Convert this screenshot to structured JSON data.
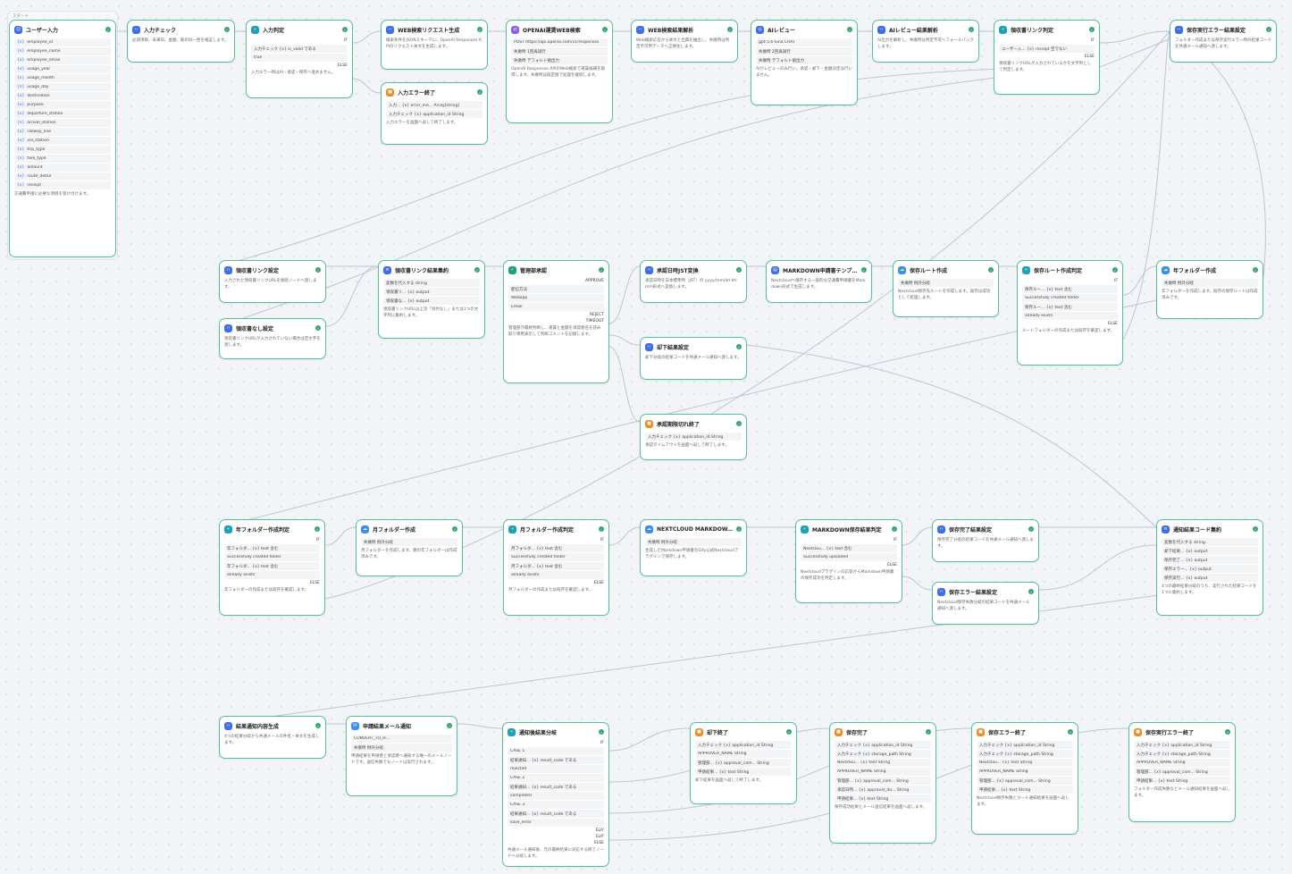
{
  "canvas": {
    "group_label": "スタート"
  },
  "nodes": [
    {
      "title": "ユーザー入力",
      "icon": "user-icon",
      "color": "#3b6ff0",
      "rows": [
        "employee_id",
        "employee_name",
        "employee_email",
        "usage_year",
        "usage_month",
        "usage_day",
        "destination",
        "purpose",
        "departure_station",
        "arrival_station",
        "railway_line",
        "via_station",
        "trip_type",
        "fare_type",
        "amount",
        "route_detail",
        "receipt"
      ],
      "desc": "交通費申請に必要な項目を受け付けます。"
    },
    {
      "title": "入力チェック",
      "icon": "code-icon",
      "color": "#3b6ff0",
      "rows": [],
      "desc": "必須項目、未来日、金額、駅の同一性を検証します。"
    },
    {
      "title": "入力判定",
      "icon": "branch-icon",
      "color": "#1aa3b8",
      "rows": [
        "入力チェック {x} is_valid である",
        "true"
      ],
      "labels": [
        "IF",
        "ELSE"
      ],
      "desc": "入力エラー時はAI・承認・保存へ進めません。"
    },
    {
      "title": "入力エラー終了",
      "icon": "end-icon",
      "color": "#f08c1e",
      "rows": [
        "入力... {x} error_me... Array[string]",
        "入力チェック {x} application_id String"
      ],
      "desc": "入力エラーを画面へ返して終了します。"
    },
    {
      "title": "WEB検索リクエスト生成",
      "icon": "code-icon",
      "color": "#3b6ff0",
      "rows": [],
      "desc": "検索条件をJSONスキーマに、OpenAI Responses APIのリクエスト本文を生成します。"
    },
    {
      "title": "OPENAI運賃WEB検索",
      "icon": "api-icon",
      "color": "#8b5cf6",
      "rows": [
        "POST https://api.openai.com/v1/responses",
        "失敗時 1回再試行",
        "失敗時 デフォルト値出力"
      ],
      "desc": "OpenAI Responses APIのWeb検索で運賃候補を取得します。失敗時は既定値で処理を継続します。"
    },
    {
      "title": "WEB検索結果解析",
      "icon": "code-icon",
      "color": "#3b6ff0",
      "rows": [],
      "desc": "Web検索応答から本文と出典を抽出し、失敗時は判定不可用データへ正規化します。"
    },
    {
      "title": "AIレビュー",
      "icon": "llm-icon",
      "color": "#3b6ff0",
      "rows": [
        "gpt-5.6-luna CHAT",
        "失敗時 2回再試行",
        "失敗時 デフォルト値出力"
      ],
      "desc": "AIがレビューのみ行い、承認・却下・金額決定は行いません。"
    },
    {
      "title": "AIレビュー結果解析",
      "icon": "code-icon",
      "color": "#3b6ff0",
      "rows": [],
      "desc": "AI出力を解析し、失敗時は判定不可へフォールバックします。"
    },
    {
      "title": "領収書リンク判定",
      "icon": "branch-icon",
      "color": "#1aa3b8",
      "rows": [
        "ユーザー入... {x} receipt 空でない"
      ],
      "labels": [
        "IF",
        "ELSE"
      ],
      "desc": "領収書リンクURLが入力されているかを文字列として判定します。"
    },
    {
      "title": "保存実行エラー結果設定",
      "icon": "code-icon",
      "color": "#3b6ff0",
      "rows": [],
      "desc": "フォルダー作成または保存実行エラー時の結果コードを共通メール通知へ渡します。"
    },
    {
      "title": "領収書リンク設定",
      "icon": "code-icon",
      "color": "#3b6ff0",
      "rows": [],
      "desc": "入力された領収書リンクURLを後続ノードへ渡します。"
    },
    {
      "title": "領収書なし設定",
      "icon": "code-icon",
      "color": "#3b6ff0",
      "rows": [],
      "desc": "領収書リンクURLが入力されていない場合は空文字を渡します。"
    },
    {
      "title": "領収書リンク結果集約",
      "icon": "agg-icon",
      "color": "#3b6ff0",
      "rows": [
        "変数を代入する string",
        "領収書リ... {x} output",
        "領収書な... {x} output"
      ],
      "desc": "領収書リンクURLは上流「添付なし」または1つの文字列に集約します。"
    },
    {
      "title": "管理部承認",
      "icon": "human-icon",
      "color": "#1aa37a",
      "rows": [
        "配信方法",
        "Webapp",
        "Email"
      ],
      "labels": [
        "APPROVE",
        "REJECT",
        "TIMEOUT"
      ],
      "desc": "管理部が最終判断し、運賃と金額を承認者名を読み取り専用表示して判断コメントを記録します。"
    },
    {
      "title": "承認日時JST変換",
      "icon": "code-icon",
      "color": "#3b6ff0",
      "rows": [],
      "desc": "承認日時を日本標準時（JST）の yyyy/mm/dd hh:mm形式へ変換します。"
    },
    {
      "title": "MARKDOWN申請書テンプ...",
      "icon": "doc-icon",
      "color": "#3b6ff0",
      "rows": [],
      "desc": "Nextcloudへ保存する一般的な交通費申請書をMarkdown形式で生成します。"
    },
    {
      "title": "保存ルート作成",
      "icon": "cloud-icon",
      "color": "#3b8ff0",
      "rows": [
        "失敗時 例外分岐"
      ],
      "desc": "Nextcloud保存先ルートを作成します。既存は成功として処理します。"
    },
    {
      "title": "保存ルート作成判定",
      "icon": "branch-icon",
      "color": "#1aa3b8",
      "rows": [
        "保存ルー... {x} text 含む",
        "Successfully created folder",
        "保存ルー... {x} text 含む",
        "already exists"
      ],
      "labels": [
        "IF",
        "ELSE"
      ],
      "desc": "ルートフォルダーの作成または既存を確認します。"
    },
    {
      "title": "年フォルダー作成",
      "icon": "cloud-icon",
      "color": "#3b8ff0",
      "rows": [
        "失敗時 例外分岐"
      ],
      "desc": "年フォルダーを作成します。既存の保存ルートは作成済みです。"
    },
    {
      "title": "却下結果設定",
      "icon": "code-icon",
      "color": "#3b6ff0",
      "rows": [],
      "desc": "却下分岐の結果コードを共通メール通知へ渡します。"
    },
    {
      "title": "承認期限切れ終了",
      "icon": "end-icon",
      "color": "#f08c1e",
      "rows": [
        "入力チェック {x} application_id String"
      ],
      "desc": "承認タイムアウトを画面へ返して終了します。"
    },
    {
      "title": "年フォルダー作成判定",
      "icon": "branch-icon",
      "color": "#1aa3b8",
      "rows": [
        "年フォルダ... {x} text 含む",
        "Successfully created folder",
        "年フォルダ... {x} text 含む",
        "already exists"
      ],
      "labels": [
        "IF",
        "ELSE"
      ],
      "desc": "年フォルダーの作成または既存を確認します。"
    },
    {
      "title": "月フォルダー作成",
      "icon": "cloud-icon",
      "color": "#3b8ff0",
      "rows": [
        "失敗時 例外分岐"
      ],
      "desc": "月フォルダーを作成します。親の年フォルダーは作成済みです。"
    },
    {
      "title": "月フォルダー作成判定",
      "icon": "branch-icon",
      "color": "#1aa3b8",
      "rows": [
        "月フォルダ... {x} text 含む",
        "Successfully created folder",
        "月フォルダ... {x} text 含む",
        "already exists"
      ],
      "labels": [
        "IF",
        "ELSE"
      ],
      "desc": "月フォルダーの作成または既存を確認します。"
    },
    {
      "title": "NEXTCLOUD MARKDOW...",
      "icon": "cloud-icon",
      "color": "#3b8ff0",
      "rows": [
        "失敗時 例外分岐"
      ],
      "desc": "生成したMarkdown申請書をDify公式Nextcloudプラグインで保存します。"
    },
    {
      "title": "MARKDOWN保存結果判定",
      "icon": "branch-icon",
      "color": "#1aa3b8",
      "rows": [
        "Nextclou... {x} text 含む",
        "Successfully uploaded"
      ],
      "labels": [
        "IF",
        "ELSE"
      ],
      "desc": "Nextcloudプラグインの応答からMarkdown申請書の保存成功を判定します。"
    },
    {
      "title": "保存完了結果設定",
      "icon": "code-icon",
      "color": "#3b6ff0",
      "rows": [],
      "desc": "保存完了分岐の結果コードを共通メール通知へ渡します。"
    },
    {
      "title": "保存エラー結果設定",
      "icon": "code-icon",
      "color": "#3b6ff0",
      "rows": [],
      "desc": "Nextcloud保存失敗分岐の結果コードを共通メール通知へ渡します。"
    },
    {
      "title": "通知結果コード集約",
      "icon": "agg-icon",
      "color": "#3b6ff0",
      "rows": [
        "変数を代入する string",
        "却下結果... {x} output",
        "保存完了... {x} output",
        "保存エラー... {x} output",
        "保存実行... {x} output"
      ],
      "desc": "4つの最終結果分岐のうち、実行された結果コードを1つに集約します。"
    },
    {
      "title": "結果通知内容生成",
      "icon": "code-icon",
      "color": "#3b6ff0",
      "rows": [],
      "desc": "4つの結果分岐から共通メールの件名・本文を生成します。"
    },
    {
      "title": "申請結果メール通知",
      "icon": "mail-icon",
      "color": "#3b8ff0",
      "rows": [
        "CONVERT_TO_H...",
        "失敗時 例外分岐"
      ],
      "desc": "申請結果を申請者と承認者へ通知する唯一のメールノードです。送信失敗でもノードは実行されます。"
    },
    {
      "title": "通知後結果分岐",
      "icon": "branch-icon",
      "color": "#1aa3b8",
      "rows": [
        "CASE 1",
        "結果通知... {x} result_code である",
        "rejected",
        "CASE 2",
        "結果通知... {x} result_code である",
        "completed",
        "CASE 3",
        "結果通知... {x} result_code である",
        "save_error"
      ],
      "labels": [
        "IF",
        "ELIF",
        "ELIF",
        "ELSE"
      ],
      "desc": "共通メール通知後、元の最終結果に対応する終了ノードへ分岐します。"
    },
    {
      "title": "却下終了",
      "icon": "end-icon",
      "color": "#f08c1e",
      "rows": [
        "入力チェック {x} application_id String",
        "APPROVER_NAME String",
        "管理部... {x} approval_com... String",
        "申請結果... {x} text String"
      ],
      "desc": "却下結果を画面へ返して終了します。"
    },
    {
      "title": "保存完了",
      "icon": "end-icon",
      "color": "#f08c1e",
      "rows": [
        "入力チェック {x} application_id String",
        "入力チェック {x} storage_path String",
        "Nextclou... {x} text String",
        "APPROVER_NAME String",
        "管理部... {x} approval_com... String",
        "承認日時... {x} approval_da... String",
        "申請結果... {x} text String"
      ],
      "desc": "保存成功結果とメール送信結果を画面へ返します。"
    },
    {
      "title": "保存エラー終了",
      "icon": "end-icon",
      "color": "#f08c1e",
      "rows": [
        "入力チェック {x} application_id String",
        "入力チェック {x} storage_path String",
        "Nextclou... {x} text String",
        "APPROVER_NAME String",
        "管理部... {x} approval_com... String",
        "申請結果... {x} text String"
      ],
      "desc": "Nextcloud保存失敗とメール通知結果を画面へ返します。"
    },
    {
      "title": "保存実行エラー終了",
      "icon": "end-icon",
      "color": "#f08c1e",
      "rows": [
        "入力チェック {x} application_id String",
        "入力チェック {x} storage_path String",
        "APPROVER_NAME String",
        "管理部... {x} approval_com... String",
        "申請結果... {x} text String"
      ],
      "desc": "フォルダー作成失敗などメール通知結果を画面へ返します。"
    }
  ]
}
